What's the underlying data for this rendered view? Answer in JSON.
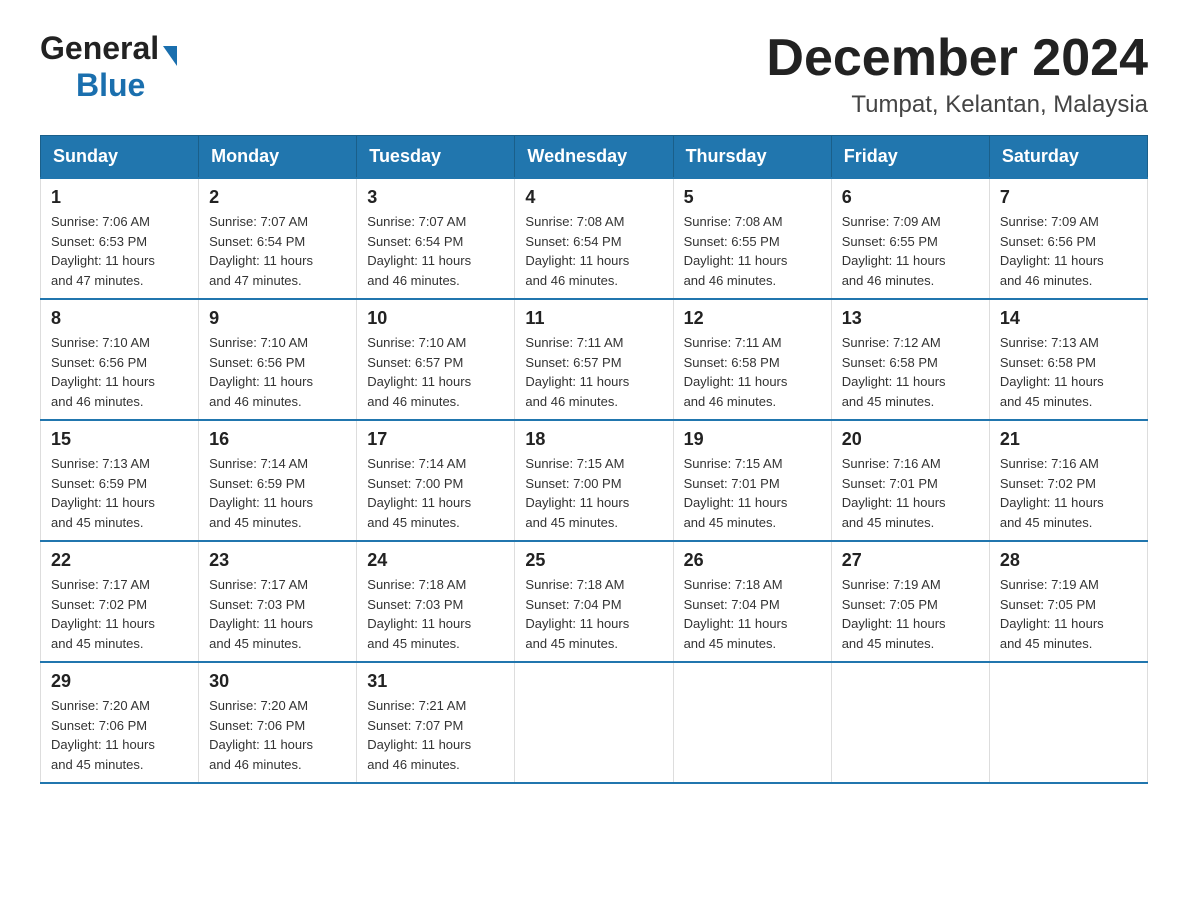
{
  "header": {
    "logo_general": "General",
    "logo_blue": "Blue",
    "month_title": "December 2024",
    "location": "Tumpat, Kelantan, Malaysia"
  },
  "weekdays": [
    "Sunday",
    "Monday",
    "Tuesday",
    "Wednesday",
    "Thursday",
    "Friday",
    "Saturday"
  ],
  "weeks": [
    [
      {
        "day": "1",
        "sunrise": "7:06 AM",
        "sunset": "6:53 PM",
        "daylight": "11 hours and 47 minutes."
      },
      {
        "day": "2",
        "sunrise": "7:07 AM",
        "sunset": "6:54 PM",
        "daylight": "11 hours and 47 minutes."
      },
      {
        "day": "3",
        "sunrise": "7:07 AM",
        "sunset": "6:54 PM",
        "daylight": "11 hours and 46 minutes."
      },
      {
        "day": "4",
        "sunrise": "7:08 AM",
        "sunset": "6:54 PM",
        "daylight": "11 hours and 46 minutes."
      },
      {
        "day": "5",
        "sunrise": "7:08 AM",
        "sunset": "6:55 PM",
        "daylight": "11 hours and 46 minutes."
      },
      {
        "day": "6",
        "sunrise": "7:09 AM",
        "sunset": "6:55 PM",
        "daylight": "11 hours and 46 minutes."
      },
      {
        "day": "7",
        "sunrise": "7:09 AM",
        "sunset": "6:56 PM",
        "daylight": "11 hours and 46 minutes."
      }
    ],
    [
      {
        "day": "8",
        "sunrise": "7:10 AM",
        "sunset": "6:56 PM",
        "daylight": "11 hours and 46 minutes."
      },
      {
        "day": "9",
        "sunrise": "7:10 AM",
        "sunset": "6:56 PM",
        "daylight": "11 hours and 46 minutes."
      },
      {
        "day": "10",
        "sunrise": "7:10 AM",
        "sunset": "6:57 PM",
        "daylight": "11 hours and 46 minutes."
      },
      {
        "day": "11",
        "sunrise": "7:11 AM",
        "sunset": "6:57 PM",
        "daylight": "11 hours and 46 minutes."
      },
      {
        "day": "12",
        "sunrise": "7:11 AM",
        "sunset": "6:58 PM",
        "daylight": "11 hours and 46 minutes."
      },
      {
        "day": "13",
        "sunrise": "7:12 AM",
        "sunset": "6:58 PM",
        "daylight": "11 hours and 45 minutes."
      },
      {
        "day": "14",
        "sunrise": "7:13 AM",
        "sunset": "6:58 PM",
        "daylight": "11 hours and 45 minutes."
      }
    ],
    [
      {
        "day": "15",
        "sunrise": "7:13 AM",
        "sunset": "6:59 PM",
        "daylight": "11 hours and 45 minutes."
      },
      {
        "day": "16",
        "sunrise": "7:14 AM",
        "sunset": "6:59 PM",
        "daylight": "11 hours and 45 minutes."
      },
      {
        "day": "17",
        "sunrise": "7:14 AM",
        "sunset": "7:00 PM",
        "daylight": "11 hours and 45 minutes."
      },
      {
        "day": "18",
        "sunrise": "7:15 AM",
        "sunset": "7:00 PM",
        "daylight": "11 hours and 45 minutes."
      },
      {
        "day": "19",
        "sunrise": "7:15 AM",
        "sunset": "7:01 PM",
        "daylight": "11 hours and 45 minutes."
      },
      {
        "day": "20",
        "sunrise": "7:16 AM",
        "sunset": "7:01 PM",
        "daylight": "11 hours and 45 minutes."
      },
      {
        "day": "21",
        "sunrise": "7:16 AM",
        "sunset": "7:02 PM",
        "daylight": "11 hours and 45 minutes."
      }
    ],
    [
      {
        "day": "22",
        "sunrise": "7:17 AM",
        "sunset": "7:02 PM",
        "daylight": "11 hours and 45 minutes."
      },
      {
        "day": "23",
        "sunrise": "7:17 AM",
        "sunset": "7:03 PM",
        "daylight": "11 hours and 45 minutes."
      },
      {
        "day": "24",
        "sunrise": "7:18 AM",
        "sunset": "7:03 PM",
        "daylight": "11 hours and 45 minutes."
      },
      {
        "day": "25",
        "sunrise": "7:18 AM",
        "sunset": "7:04 PM",
        "daylight": "11 hours and 45 minutes."
      },
      {
        "day": "26",
        "sunrise": "7:18 AM",
        "sunset": "7:04 PM",
        "daylight": "11 hours and 45 minutes."
      },
      {
        "day": "27",
        "sunrise": "7:19 AM",
        "sunset": "7:05 PM",
        "daylight": "11 hours and 45 minutes."
      },
      {
        "day": "28",
        "sunrise": "7:19 AM",
        "sunset": "7:05 PM",
        "daylight": "11 hours and 45 minutes."
      }
    ],
    [
      {
        "day": "29",
        "sunrise": "7:20 AM",
        "sunset": "7:06 PM",
        "daylight": "11 hours and 45 minutes."
      },
      {
        "day": "30",
        "sunrise": "7:20 AM",
        "sunset": "7:06 PM",
        "daylight": "11 hours and 46 minutes."
      },
      {
        "day": "31",
        "sunrise": "7:21 AM",
        "sunset": "7:07 PM",
        "daylight": "11 hours and 46 minutes."
      },
      null,
      null,
      null,
      null
    ]
  ],
  "labels": {
    "sunrise": "Sunrise:",
    "sunset": "Sunset:",
    "daylight": "Daylight:"
  }
}
